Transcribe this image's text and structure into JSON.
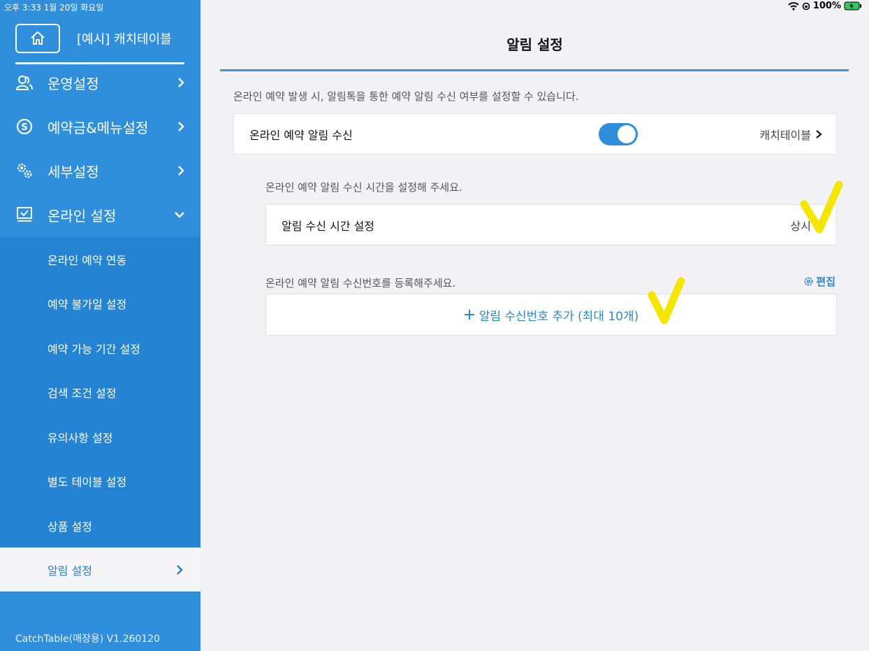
{
  "status_bar": {
    "time_date": "오후 3:33  1월 20일 화요일",
    "battery": "100%"
  },
  "sidebar": {
    "store_name": "[예시] 캐치테이블",
    "menu": [
      {
        "label": "운영설정",
        "icon": "people-icon"
      },
      {
        "label": "예약금&메뉴설정",
        "icon": "coin-icon"
      },
      {
        "label": "세부설정",
        "icon": "gears-icon"
      },
      {
        "label": "온라인 설정",
        "icon": "monitor-check-icon"
      }
    ],
    "submenu": [
      {
        "label": "온라인 예약 연동"
      },
      {
        "label": "예약 불가일 설정"
      },
      {
        "label": "예약 가능 기간 설정"
      },
      {
        "label": "검색 조건 설정"
      },
      {
        "label": "유의사항 설정"
      },
      {
        "label": "별도 테이블 설정"
      },
      {
        "label": "상품 설정"
      },
      {
        "label": "알림 설정"
      }
    ],
    "active_submenu": "알림 설정",
    "version": "CatchTable(매장용) V1.260120"
  },
  "main": {
    "title": "알림 설정",
    "description": "온라인 예약 발생 시, 알림톡을 통한 예약 알림 수신 여부를 설정할 수 있습니다.",
    "notify_row": {
      "label": "온라인 예약 알림 수신",
      "toggle_on": true,
      "right_label": "캐치테이블"
    },
    "time_section": {
      "prompt": "온라인 예약 알림 수신 시간을 설정해 주세요.",
      "row_label": "알림 수신 시간 설정",
      "row_value": "상시"
    },
    "number_section": {
      "prompt": "온라인 예약 알림 수신번호를 등록해주세요.",
      "edit_label": "편집",
      "add_label": "알림 수신번호 추가 (최대 10개)"
    }
  },
  "colors": {
    "sidebar": "#2f8fdd",
    "submenu": "#2483d3",
    "accent": "#2a86d6",
    "annotation_check": "#f4e600"
  }
}
